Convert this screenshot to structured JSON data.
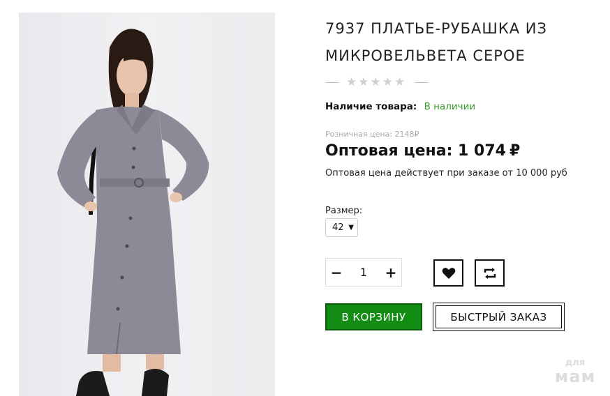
{
  "product": {
    "title": "7937 ПЛАТЬЕ-РУБАШКА ИЗ МИКРОВЕЛЬВЕТА СЕРОЕ",
    "image_alt": "Model wearing grey corduroy shirt dress"
  },
  "rating": {
    "stars_filled": 0,
    "stars_total": 5
  },
  "availability": {
    "label": "Наличие товара:",
    "value": "В наличии"
  },
  "price": {
    "retail": "Розничная цена: 2148₽",
    "wholesale_label": "Оптовая цена: 1 074",
    "currency": "₽",
    "note": "Оптовая цена действует при заказе от 10 000 руб"
  },
  "size": {
    "label": "Размер:",
    "selected": "42"
  },
  "quantity": {
    "minus": "−",
    "value": "1",
    "plus": "+"
  },
  "actions": {
    "cart": "В КОРЗИНУ",
    "quick_order": "БЫСТРЫЙ ЗАКАЗ"
  },
  "watermark": {
    "line1": "для",
    "line2": "мам"
  },
  "colors": {
    "in_stock": "#3a9b2d",
    "cart_bg": "#128c13",
    "dress": "#8d8996"
  },
  "icons": {
    "wishlist": "heart-icon",
    "compare": "compare-arrows-icon",
    "size_dropdown": "chevron-down-icon",
    "rating_star": "star-icon"
  }
}
